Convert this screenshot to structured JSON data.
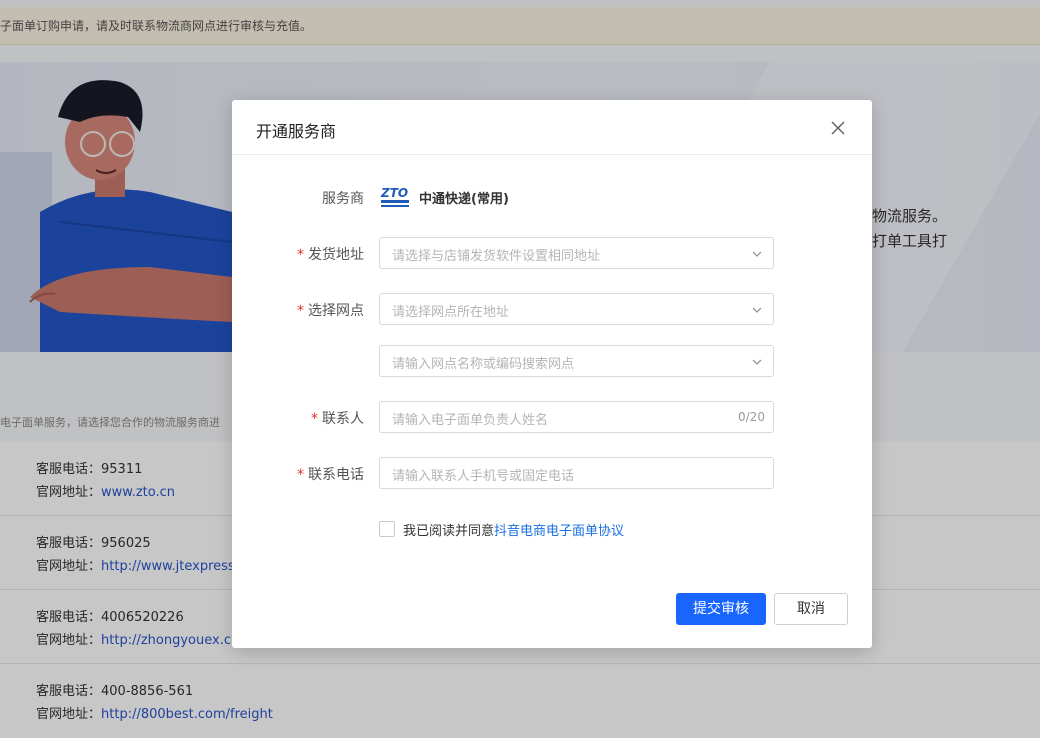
{
  "background": {
    "notice": "子面单订购申请，请及时联系物流商网点进行审核与充值。",
    "hero_line1": "物流服务。",
    "hero_line2": "打单工具打",
    "description": "电子面单服务，请选择您合作的物流服务商进",
    "services": [
      {
        "phone_label": "客服电话：",
        "phone": "95311",
        "site_label": "官网地址：",
        "site": "www.zto.cn"
      },
      {
        "phone_label": "客服电话：",
        "phone": "956025",
        "site_label": "官网地址：",
        "site": "http://www.jtexpress"
      },
      {
        "phone_label": "客服电话：",
        "phone": "4006520226",
        "site_label": "官网地址：",
        "site": "http://zhongyouex.c"
      },
      {
        "phone_label": "客服电话：",
        "phone": "400-8856-561",
        "site_label": "官网地址：",
        "site": "http://800best.com/freight"
      }
    ]
  },
  "modal": {
    "title": "开通服务商",
    "provider": {
      "label": "服务商",
      "name": "中通快递(常用)"
    },
    "fields": {
      "address": {
        "label": "发货地址",
        "placeholder": "请选择与店铺发货软件设置相同地址"
      },
      "outlet": {
        "label": "选择网点",
        "placeholder": "请选择网点所在地址"
      },
      "outlet_search": {
        "placeholder": "请输入网点名称或编码搜索网点"
      },
      "contact": {
        "label": "联系人",
        "placeholder": "请输入电子面单负责人姓名",
        "counter": "0/20"
      },
      "phone": {
        "label": "联系电话",
        "placeholder": "请输入联系人手机号或固定电话"
      }
    },
    "agreement": {
      "text": "我已阅读并同意",
      "link": "抖音电商电子面单协议"
    },
    "buttons": {
      "submit": "提交审核",
      "cancel": "取消"
    }
  },
  "colors": {
    "primary": "#1966ff",
    "required": "#e0312f",
    "link": "#1a6fe0"
  }
}
